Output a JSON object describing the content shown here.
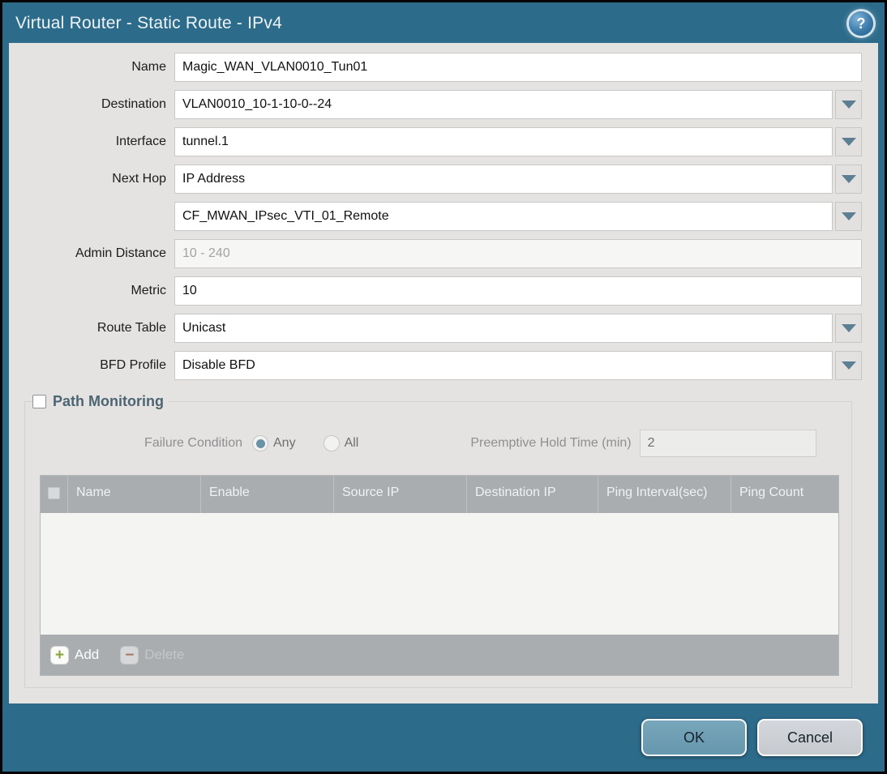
{
  "window": {
    "title": "Virtual Router - Static Route - IPv4"
  },
  "icons": {
    "help": "?",
    "add": "+",
    "delete": "−"
  },
  "form": {
    "name": {
      "label": "Name",
      "value": "Magic_WAN_VLAN0010_Tun01"
    },
    "destination": {
      "label": "Destination",
      "value": "VLAN0010_10-1-10-0--24"
    },
    "interface": {
      "label": "Interface",
      "value": "tunnel.1"
    },
    "next_hop": {
      "label": "Next Hop",
      "value": "IP Address"
    },
    "next_hop_address": {
      "value": "CF_MWAN_IPsec_VTI_01_Remote"
    },
    "admin_distance": {
      "label": "Admin Distance",
      "value": "",
      "placeholder": "10 - 240"
    },
    "metric": {
      "label": "Metric",
      "value": "10"
    },
    "route_table": {
      "label": "Route Table",
      "value": "Unicast"
    },
    "bfd_profile": {
      "label": "BFD Profile",
      "value": "Disable BFD"
    }
  },
  "path_monitoring": {
    "title": "Path Monitoring",
    "enabled": false,
    "failure_condition": {
      "label": "Failure Condition",
      "options": [
        {
          "label": "Any",
          "selected": true
        },
        {
          "label": "All",
          "selected": false
        }
      ]
    },
    "preemptive_hold_time": {
      "label": "Preemptive Hold Time (min)",
      "value": "2"
    },
    "table": {
      "columns": [
        "Name",
        "Enable",
        "Source IP",
        "Destination IP",
        "Ping Interval(sec)",
        "Ping Count"
      ],
      "rows": []
    },
    "toolbar": {
      "add_label": "Add",
      "delete_label": "Delete"
    }
  },
  "footer": {
    "ok_label": "OK",
    "cancel_label": "Cancel"
  },
  "colors": {
    "titlebar": "#2d6b8a",
    "body": "#e4e3e1",
    "table_header": "#a9adb0",
    "ok_button": "#6e9fb4",
    "cancel_button": "#cbcfd3",
    "section_title": "#4c6573",
    "add_icon_green": "#8aa43c",
    "delete_icon_red": "#a0522d"
  }
}
